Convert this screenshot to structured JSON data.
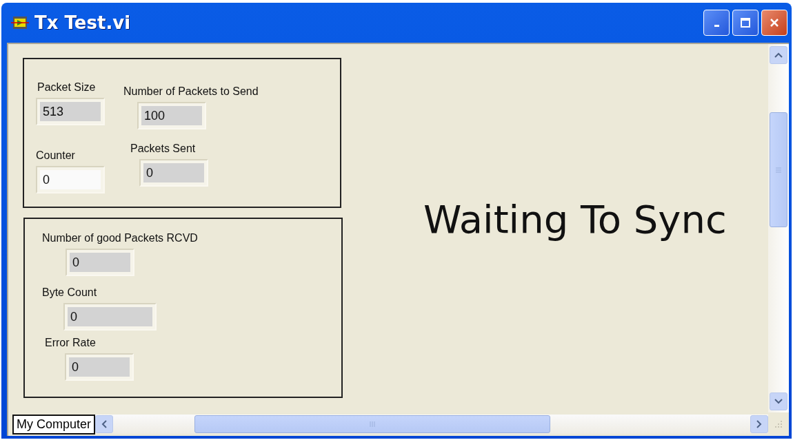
{
  "window": {
    "title": "Tx Test.vi"
  },
  "panels": [
    {
      "controls": [
        {
          "label": "Packet Size",
          "value": "513",
          "kind": "indicator"
        },
        {
          "label": "Number of Packets to Send",
          "value": "100",
          "kind": "indicator"
        },
        {
          "label": "Counter",
          "value": "0",
          "kind": "control"
        },
        {
          "label": "Packets Sent",
          "value": "0",
          "kind": "indicator"
        }
      ]
    },
    {
      "controls": [
        {
          "label": "Number of good Packets RCVD",
          "value": "0",
          "kind": "indicator"
        },
        {
          "label": "Byte Count",
          "value": "0",
          "kind": "indicator"
        },
        {
          "label": "Error Rate",
          "value": "0",
          "kind": "indicator"
        }
      ]
    }
  ],
  "status_text": "Waiting To Sync",
  "context": "My Computer"
}
